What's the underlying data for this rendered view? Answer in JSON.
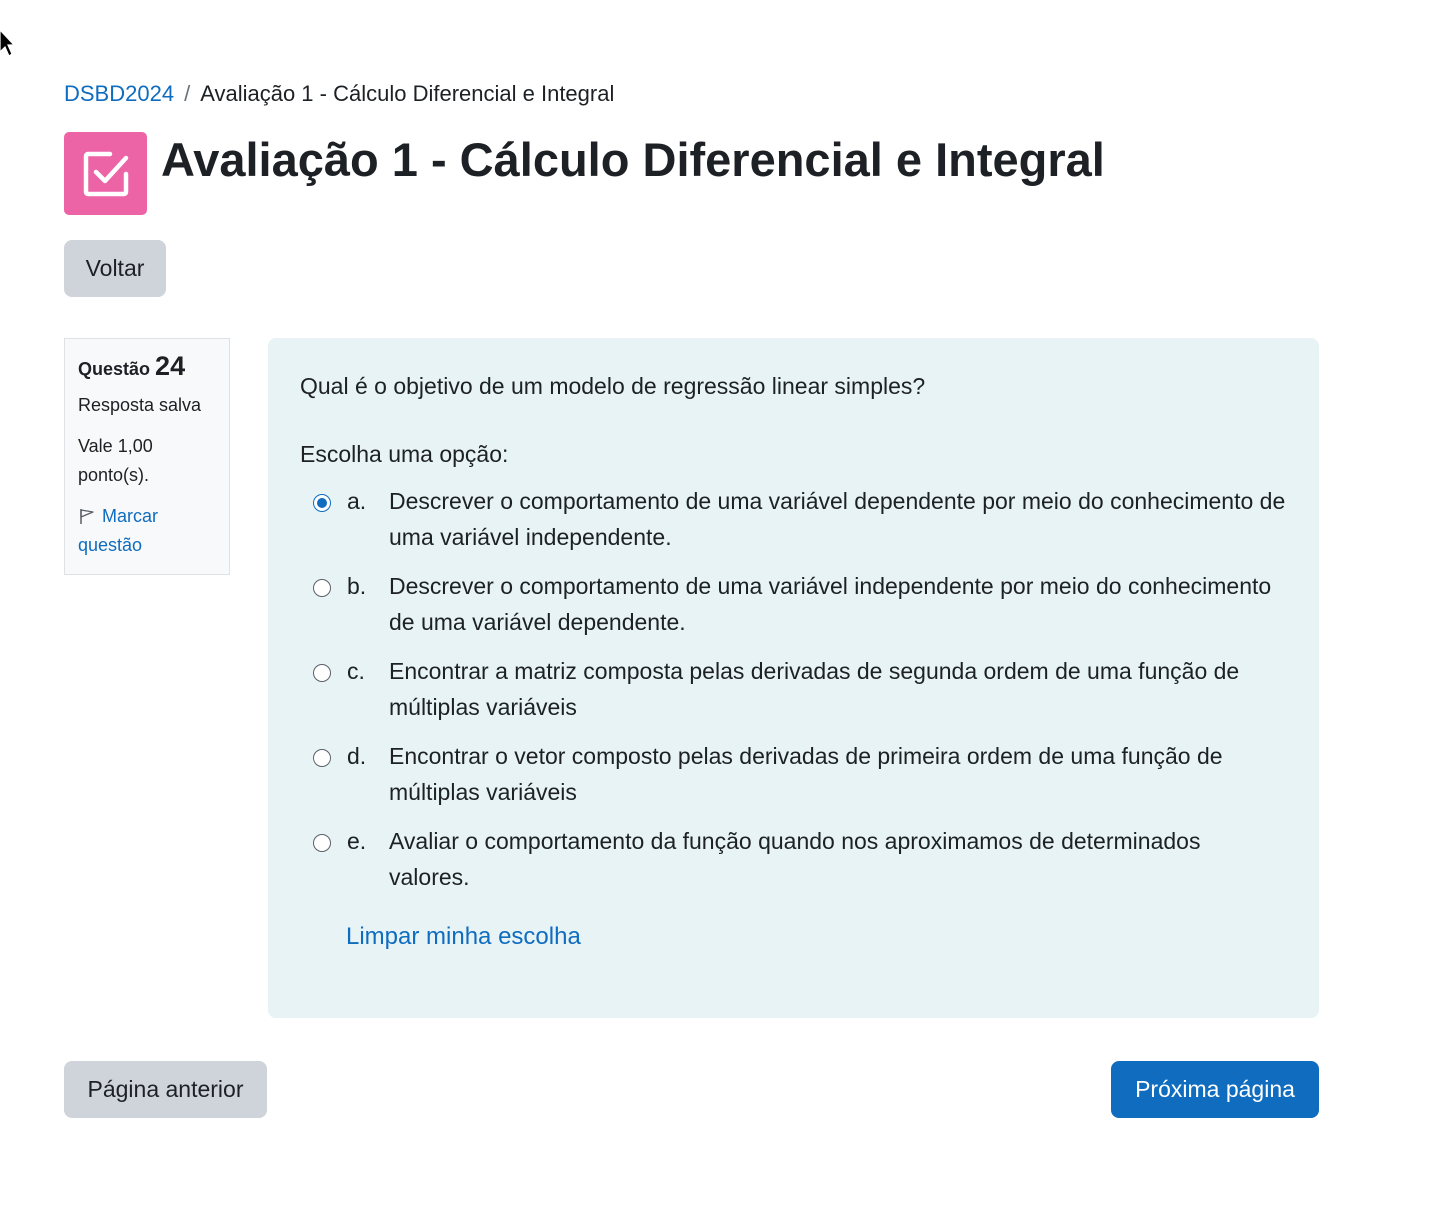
{
  "breadcrumb": {
    "course": "DSBD2024",
    "separator": "/",
    "current": "Avaliação 1 - Cálculo Diferencial e Integral"
  },
  "header": {
    "title": "Avaliação 1 - Cálculo Diferencial e Integral",
    "icon": "quiz-check-icon",
    "icon_color": "#ec63a6"
  },
  "back_button": "Voltar",
  "question_info": {
    "label": "Questão",
    "number": "24",
    "state": "Resposta salva",
    "grade": "Vale 1,00 ponto(s).",
    "flag_label": "Marcar questão"
  },
  "question": {
    "text": "Qual é o objetivo de um modelo de regressão linear simples?",
    "prompt": "Escolha uma opção:",
    "selected": "a",
    "answers": [
      {
        "letter": "a.",
        "text": "Descrever o comportamento de uma variável dependente por meio do conhecimento de uma variável independente."
      },
      {
        "letter": "b.",
        "text": "Descrever o comportamento de uma variável independente por meio do conhecimento de uma variável dependente."
      },
      {
        "letter": "c.",
        "text": "Encontrar a matriz composta pelas derivadas de segunda ordem de uma função de múltiplas variáveis"
      },
      {
        "letter": "d.",
        "text": "Encontrar o vetor composto pelas derivadas de primeira ordem de uma função de múltiplas variáveis"
      },
      {
        "letter": "e.",
        "text": "Avaliar o comportamento da função quando nos aproximamos de determinados valores."
      }
    ],
    "clear_label": "Limpar minha escolha"
  },
  "navigation": {
    "prev_label": "Página anterior",
    "next_label": "Próxima página"
  },
  "colors": {
    "link": "#0f6cbf",
    "primary": "#0f6cbf",
    "secondary_button": "#ced4da",
    "question_bg": "#e7f3f5"
  }
}
